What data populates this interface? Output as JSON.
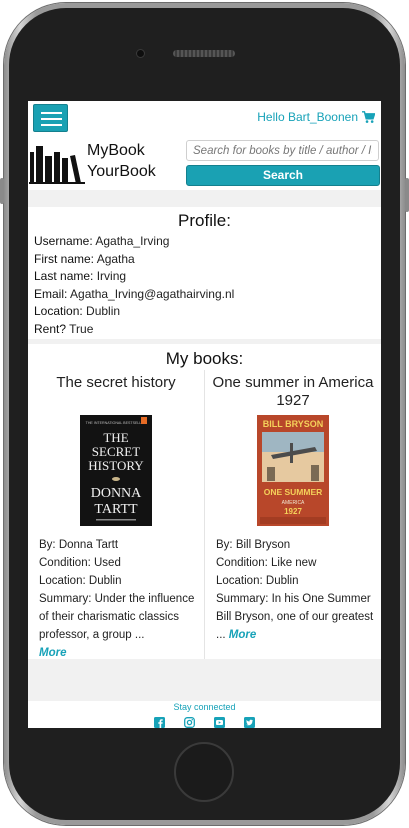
{
  "header": {
    "greeting": "Hello Bart_Boonen",
    "brand_line1": "MyBook",
    "brand_line2": "YourBook",
    "search_placeholder": "Search for books by title / author / ISBN",
    "search_button": "Search"
  },
  "profile": {
    "title": "Profile:",
    "fields": [
      {
        "label": "Username:",
        "value": "Agatha_Irving"
      },
      {
        "label": "First name:",
        "value": "Agatha"
      },
      {
        "label": "Last name:",
        "value": "Irving"
      },
      {
        "label": "Email:",
        "value": "Agatha_Irving@agathairving.nl"
      },
      {
        "label": "Location:",
        "value": "Dublin"
      },
      {
        "label": "Rent?",
        "value": "True"
      }
    ]
  },
  "books": {
    "title": "My books:",
    "items": [
      {
        "title": "The secret history",
        "cover": {
          "top": "THE INTERNATIONAL BESTSELLER",
          "line1": "THE",
          "line2": "SECRET",
          "line3": "HISTORY",
          "author1": "DONNA",
          "author2": "TARTT"
        },
        "by_label": "By:",
        "by": "Donna Tartt",
        "condition_label": "Condition:",
        "condition": "Used",
        "location_label": "Location:",
        "location": "Dublin",
        "summary_label": "Summary:",
        "summary": "Under the influence of their charismatic classics professor, a group ...",
        "more": "More"
      },
      {
        "title": "One summer in America 1927",
        "cover": {
          "author": "BILL BRYSON",
          "title1": "ONE SUMMER",
          "title2": "AMERICA",
          "year": "1927"
        },
        "by_label": "By:",
        "by": "Bill Bryson",
        "condition_label": "Condition:",
        "condition": "Like new",
        "location_label": "Location:",
        "location": "Dublin",
        "summary_label": "Summary:",
        "summary": "In his One Summer Bill Bryson, one of our greatest ...",
        "more": "More"
      }
    ]
  },
  "footer": {
    "stay": "Stay connected",
    "icons": [
      "facebook-icon",
      "instagram-icon",
      "youtube-icon",
      "twitter-icon"
    ]
  },
  "colors": {
    "accent": "#17a2b8"
  }
}
